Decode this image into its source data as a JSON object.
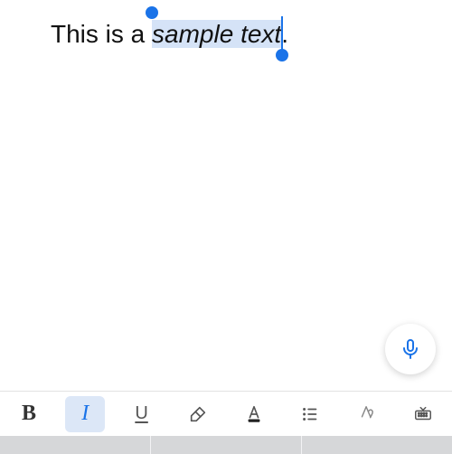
{
  "document": {
    "text_before_selection": "This is a ",
    "selected_text": "sample text",
    "text_after_selection": ".",
    "selection_italic": true
  },
  "toolbar": {
    "bold_label": "B",
    "italic_label": "I",
    "underline_label": "U",
    "active_tool": "italic"
  },
  "colors": {
    "accent": "#1a73e8",
    "highlight": "#d5e3f7"
  }
}
